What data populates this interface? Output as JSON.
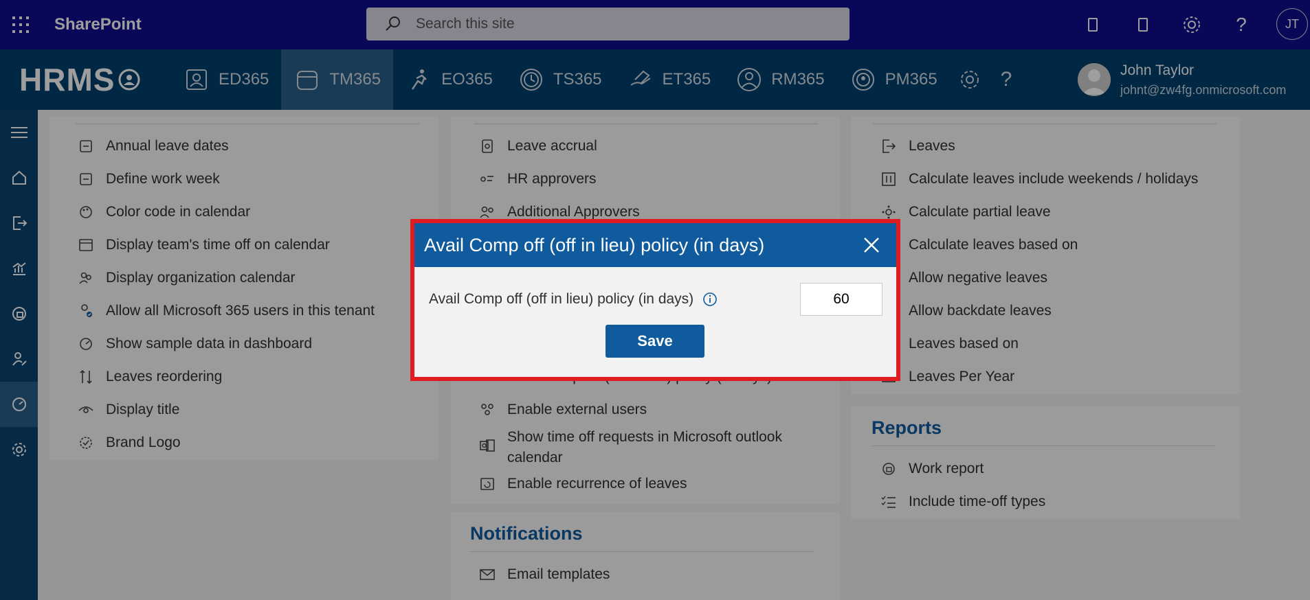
{
  "suitebar": {
    "title": "SharePoint",
    "search_placeholder": "Search this site",
    "avatar_initials": "JT"
  },
  "appbar": {
    "logo": "HRMS",
    "tabs": [
      {
        "label": "ED365"
      },
      {
        "label": "TM365"
      },
      {
        "label": "EO365"
      },
      {
        "label": "TS365"
      },
      {
        "label": "ET365"
      },
      {
        "label": "RM365"
      },
      {
        "label": "PM365"
      }
    ],
    "user_name": "John Taylor",
    "user_email": "johnt@zw4fg.onmicrosoft.com"
  },
  "col1": {
    "items": [
      "Annual leave dates",
      "Define work week",
      "Color code in calendar",
      "Display team's time off on calendar",
      "Display organization calendar",
      "Allow all Microsoft 365 users in this tenant",
      "Show sample data in dashboard",
      "Leaves reordering",
      "Display title",
      "Brand Logo"
    ]
  },
  "col2": {
    "items": [
      "Leave accrual",
      "HR approvers",
      "Additional Approvers",
      "Avail Comp off (off in lieu) policy (in days)",
      "Enable external users",
      "Show time off requests in Microsoft outlook calendar",
      "Enable recurrence of leaves"
    ],
    "notifications_title": "Notifications",
    "notifications_items": [
      "Email templates"
    ]
  },
  "col3": {
    "items": [
      "Leaves",
      "Calculate leaves include weekends / holidays",
      "Calculate partial leave",
      "Calculate leaves based on",
      "Allow negative leaves",
      "Allow backdate leaves",
      "Leaves based on",
      "Leaves Per Year"
    ],
    "reports_title": "Reports",
    "reports_items": [
      "Work report",
      "Include time-off types"
    ]
  },
  "dialog": {
    "title": "Avail Comp off (off in lieu) policy (in days)",
    "field_label": "Avail Comp off (off in lieu) policy (in days)",
    "value": "60",
    "save_label": "Save"
  }
}
